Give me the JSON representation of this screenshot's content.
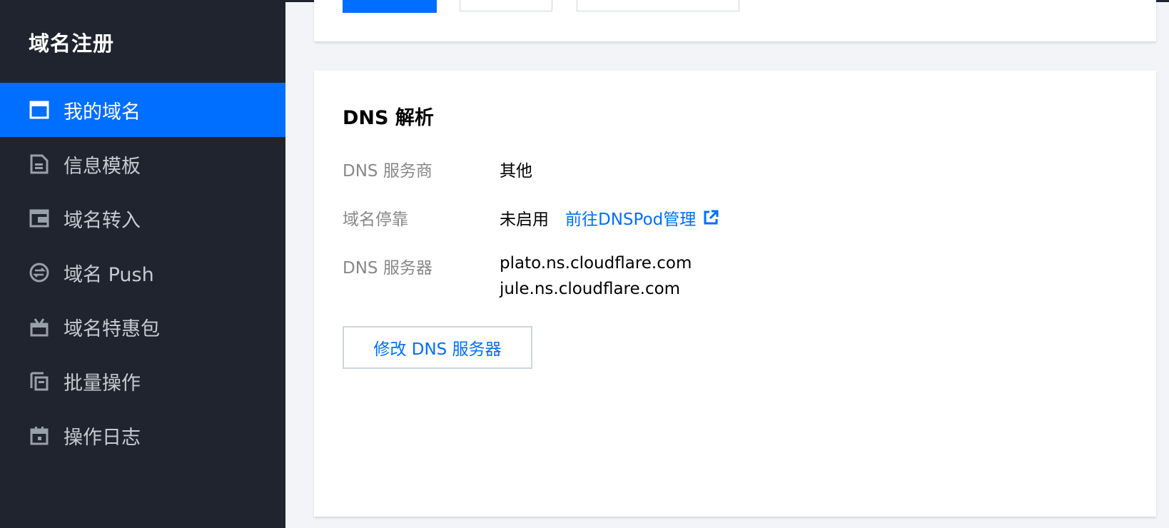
{
  "sidebar": {
    "title": "域名注册",
    "items": [
      {
        "label": "我的域名",
        "icon": "browser-window-icon",
        "active": true
      },
      {
        "label": "信息模板",
        "icon": "document-icon",
        "active": false
      },
      {
        "label": "域名转入",
        "icon": "transfer-in-icon",
        "active": false
      },
      {
        "label": "域名 Push",
        "icon": "push-icon",
        "active": false
      },
      {
        "label": "域名特惠包",
        "icon": "gift-icon",
        "active": false
      },
      {
        "label": "批量操作",
        "icon": "batch-copy-icon",
        "active": false
      },
      {
        "label": "操作日志",
        "icon": "calendar-icon",
        "active": false
      }
    ]
  },
  "dns": {
    "title": "DNS 解析",
    "provider_label": "DNS 服务商",
    "provider_value": "其他",
    "parking_label": "域名停靠",
    "parking_value": "未启用",
    "parking_link": "前往DNSPod管理",
    "servers_label": "DNS 服务器",
    "servers": [
      "plato.ns.cloudflare.com",
      "jule.ns.cloudflare.com"
    ],
    "modify_button": "修改 DNS 服务器"
  },
  "colors": {
    "sidebar_bg": "#20242e",
    "accent": "#006eff",
    "page_bg": "#f3f4f7"
  }
}
